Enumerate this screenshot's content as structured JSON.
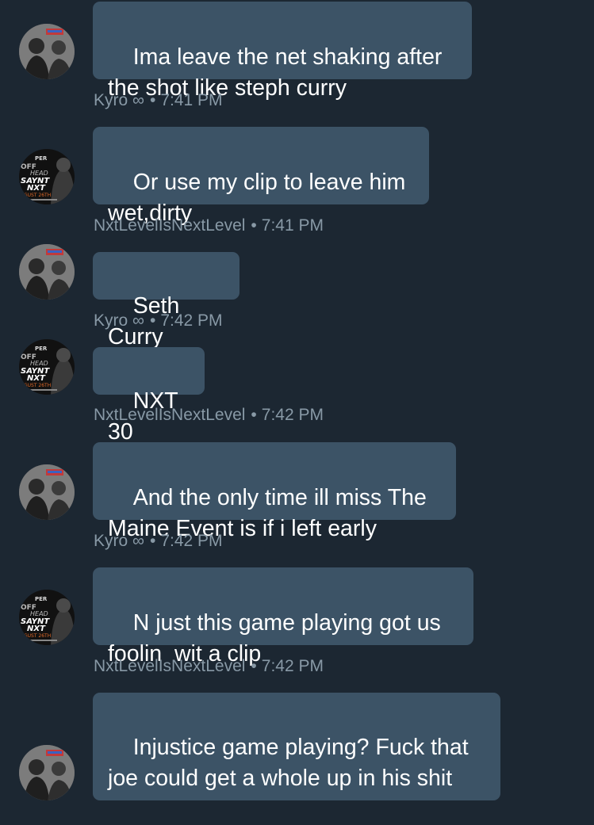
{
  "conversation": {
    "messages": [
      {
        "sender": "Kyro ∞",
        "text": "Ima leave the net shaking after the shot like steph curry",
        "time": "7:41 PM",
        "avatar_icon": "kyro-avatar"
      },
      {
        "sender": "NxtLevelIsNextLevel",
        "text": "Or use my clip to leave him wet,dirty",
        "time": "7:41 PM",
        "avatar_icon": "nxt-flyer-avatar"
      },
      {
        "sender": "Kyro ∞",
        "text": "Seth Curry",
        "time": "7:42 PM",
        "avatar_icon": "kyro-avatar"
      },
      {
        "sender": "NxtLevelIsNextLevel",
        "text": "NXT 30",
        "time": "7:42 PM",
        "avatar_icon": "nxt-flyer-avatar"
      },
      {
        "sender": "Kyro ∞",
        "text": "And the only time ill miss The Maine Event is if i left early",
        "time": "7:42 PM",
        "avatar_icon": "kyro-avatar"
      },
      {
        "sender": "NxtLevelIsNextLevel",
        "text": "N just this game playing got us foolin  wit a clip",
        "time": "7:42 PM",
        "avatar_icon": "nxt-flyer-avatar"
      },
      {
        "sender": "Kyro ∞",
        "text": "Injustice game playing? Fuck that joe could get a whole up in his shit",
        "time": "",
        "avatar_icon": "kyro-avatar"
      }
    ]
  },
  "flyer_text": [
    "PER",
    "OFF",
    "HEAD",
    "SAYNT",
    "NXT",
    "GUST 26TH"
  ],
  "colors": {
    "background": "#1c2732",
    "bubble": "#3c5366",
    "message_text": "#ffffff",
    "meta_text": "#8899a6"
  }
}
